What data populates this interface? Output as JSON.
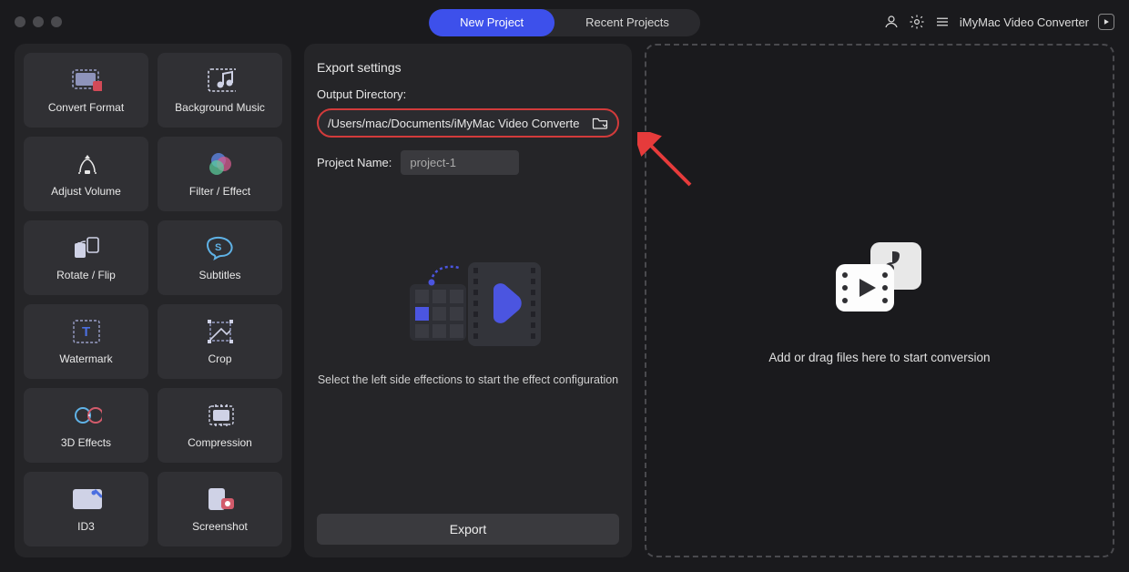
{
  "app": {
    "name": "iMyMac Video Converter"
  },
  "tabs": {
    "new_project": "New Project",
    "recent_projects": "Recent Projects"
  },
  "sidebar": {
    "tiles": [
      {
        "id": "convert-format",
        "label": "Convert Format"
      },
      {
        "id": "background-music",
        "label": "Background Music"
      },
      {
        "id": "adjust-volume",
        "label": "Adjust Volume"
      },
      {
        "id": "filter-effect",
        "label": "Filter / Effect"
      },
      {
        "id": "rotate-flip",
        "label": "Rotate / Flip"
      },
      {
        "id": "subtitles",
        "label": "Subtitles"
      },
      {
        "id": "watermark",
        "label": "Watermark"
      },
      {
        "id": "crop",
        "label": "Crop"
      },
      {
        "id": "3d-effects",
        "label": "3D Effects"
      },
      {
        "id": "compression",
        "label": "Compression"
      },
      {
        "id": "id3",
        "label": "ID3"
      },
      {
        "id": "screenshot",
        "label": "Screenshot"
      }
    ]
  },
  "export": {
    "section_title": "Export settings",
    "output_dir_label": "Output Directory:",
    "output_dir_value": "/Users/mac/Documents/iMyMac Video Converte",
    "project_name_label": "Project Name:",
    "project_name_value": "project-1",
    "hint": "Select the left side effections to start the effect configuration",
    "button": "Export"
  },
  "dropzone": {
    "hint": "Add or drag files here to start conversion"
  }
}
